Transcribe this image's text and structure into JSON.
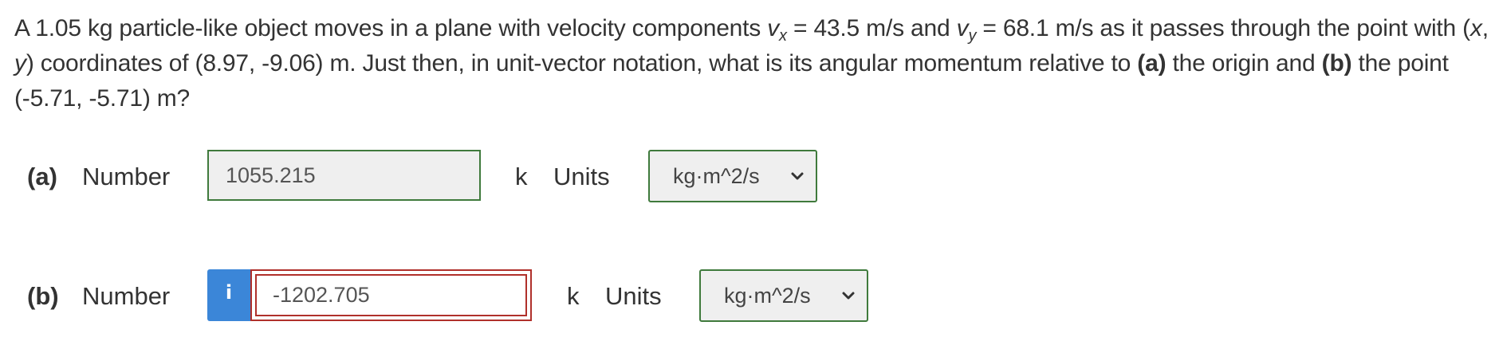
{
  "question": {
    "intro": "A 1.05 kg particle-like object moves in a plane with velocity components ",
    "vx_symbol": "v",
    "vx_sub": "x",
    "vx_rest": " = 43.5 m/s and ",
    "vy_symbol": "v",
    "vy_sub": "y",
    "vy_rest": " = 68.1 m/s as it passes through the point with (",
    "x_var": "x",
    "comma": ", ",
    "y_var": "y",
    "coords_rest": ") coordinates of (8.97, -9.06) m. Just then, in unit-vector notation, what is its angular momentum relative to ",
    "part_a_ref": "(a)",
    "mid": " the origin and ",
    "part_b_ref": "(b)",
    "end": " the point (-5.71, -5.71) m?"
  },
  "parts": [
    {
      "label": "(a)",
      "number_label": "Number",
      "value": "1055.215",
      "unit_vector": "k",
      "units_label": "Units",
      "units_selected": "kg·m^2/s",
      "status": "correct"
    },
    {
      "label": "(b)",
      "number_label": "Number",
      "info_icon": "i",
      "value": "-1202.705",
      "unit_vector": "k",
      "units_label": "Units",
      "units_selected": "kg·m^2/s",
      "status": "incorrect"
    }
  ],
  "colors": {
    "correct_border": "#3f7a3c",
    "incorrect_border": "#b0302b",
    "info_badge": "#3b86d8"
  },
  "icons": {
    "info": "info-icon",
    "dropdown": "chevron-down-icon"
  }
}
